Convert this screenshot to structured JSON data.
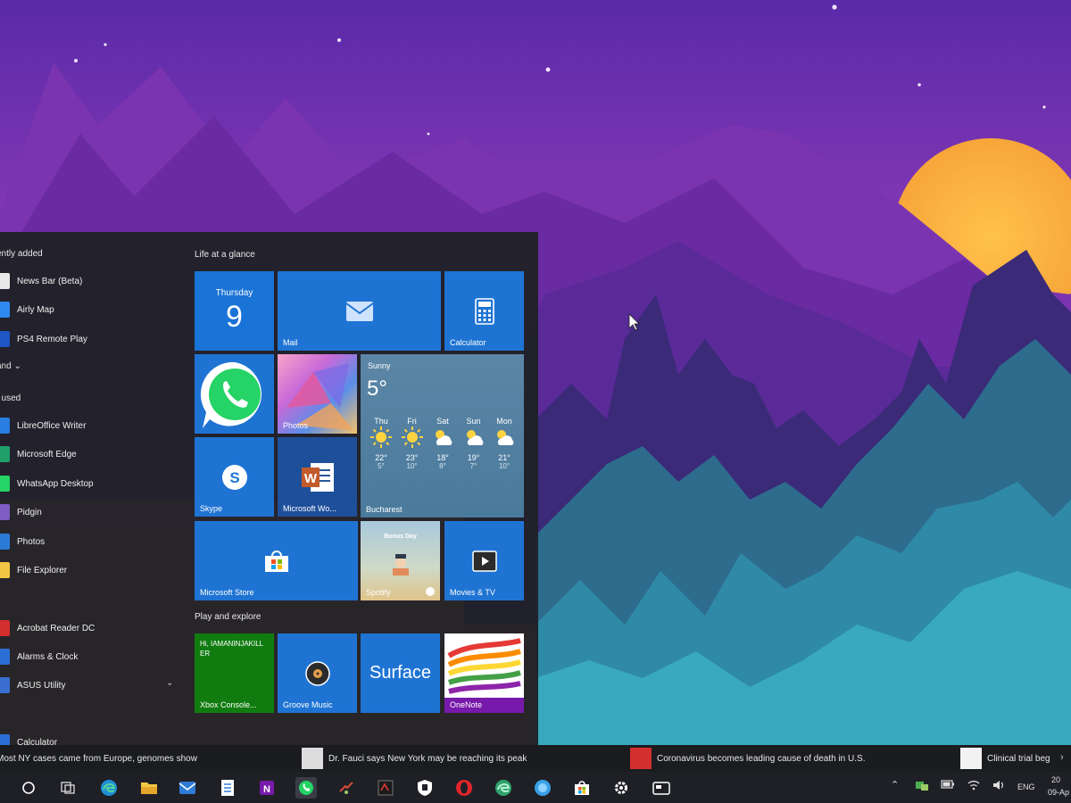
{
  "start_menu": {
    "recently_added_header": "ently added",
    "recently_added": [
      {
        "label": "News Bar (Beta)",
        "icon": "news-bar-icon",
        "color": "#e8e8e8"
      },
      {
        "label": "Airly Map",
        "icon": "airly-map-icon",
        "color": "#2d89ef"
      },
      {
        "label": "PS4 Remote Play",
        "icon": "ps4-remote-play-icon",
        "color": "#1e56c5"
      }
    ],
    "expand_label": "and ⌄",
    "most_used_header": "t used",
    "most_used": [
      {
        "label": "LibreOffice Writer",
        "icon": "libreoffice-writer-icon",
        "color": "#2a7de1"
      },
      {
        "label": "Microsoft Edge",
        "icon": "edge-icon",
        "color": "#1fa06a"
      },
      {
        "label": "WhatsApp Desktop",
        "icon": "whatsapp-icon",
        "color": "#25d366"
      },
      {
        "label": "Pidgin",
        "icon": "pidgin-icon",
        "color": "#7d5cc4"
      },
      {
        "label": "Photos",
        "icon": "photos-icon",
        "color": "#2b7bd6"
      },
      {
        "label": "File Explorer",
        "icon": "file-explorer-icon",
        "color": "#f2c744"
      }
    ],
    "alpha_list": [
      {
        "label": "Acrobat Reader DC",
        "icon": "acrobat-icon",
        "color": "#d32f2f"
      },
      {
        "label": "Alarms & Clock",
        "icon": "alarms-icon",
        "color": "#2b6fd6"
      },
      {
        "label": "ASUS Utility",
        "icon": "asus-utility-icon",
        "color": "#3a6fd0"
      },
      {
        "label": "Calculator",
        "icon": "calculator-icon",
        "color": "#2b6fd6"
      }
    ],
    "group_life": "Life at a glance",
    "group_play": "Play and explore",
    "tiles": {
      "calendar_day": "Thursday",
      "calendar_date": "9",
      "mail": "Mail",
      "calculator": "Calculator",
      "photos": "Photos",
      "weather": {
        "condition": "Sunny",
        "temp": "5°",
        "city": "Bucharest",
        "days": [
          {
            "day": "Thu",
            "hi": "22°",
            "lo": "5°"
          },
          {
            "day": "Fri",
            "hi": "23°",
            "lo": "10°"
          },
          {
            "day": "Sat",
            "hi": "18°",
            "lo": "8°"
          },
          {
            "day": "Sun",
            "hi": "19°",
            "lo": "7°"
          },
          {
            "day": "Mon",
            "hi": "21°",
            "lo": "10°"
          }
        ]
      },
      "skype": "Skype",
      "word": "Microsoft Wo...",
      "store": "Microsoft Store",
      "spotify": "Spotify",
      "spotify_banner": "Bonus Day",
      "movies": "Movies & TV",
      "xbox_text": "Hi, IAMANINJAKILLER",
      "xbox": "Xbox Console...",
      "groove": "Groove Music",
      "surface": "Surface",
      "onenote": "OneNote"
    }
  },
  "news_bar": [
    {
      "text": "Most NY cases came from Europe, genomes show"
    },
    {
      "text": "Dr. Fauci says New York may be reaching its peak"
    },
    {
      "text": "Coronavirus becomes leading cause of death in U.S."
    },
    {
      "text": "Clinical trial beg"
    }
  ],
  "taskbar": {
    "language": "ENG",
    "clock_time": "20",
    "clock_date": "09-Ap"
  }
}
